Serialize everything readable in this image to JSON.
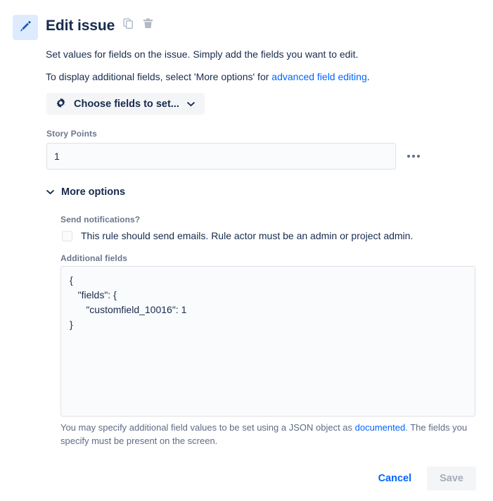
{
  "header": {
    "icon": "pencil-icon",
    "title": "Edit issue",
    "actions": [
      {
        "icon": "copy-icon",
        "name": "duplicate-rule-button"
      },
      {
        "icon": "trash-icon",
        "name": "delete-rule-button"
      }
    ],
    "description_line1": "Set values for fields on the issue. Simply add the fields you want to edit.",
    "description_line2_pre": "To display additional fields, select 'More options' for ",
    "description_line2_link": "advanced field editing",
    "description_line2_post": "."
  },
  "choose_fields": {
    "icon": "gear-icon",
    "label": "Choose fields to set...",
    "chevron": "chevron-down-icon"
  },
  "story_points": {
    "label": "Story Points",
    "value": "1",
    "placeholder": "",
    "menu_icon": "meatball-menu-icon"
  },
  "more_options": {
    "chevron": "chevron-down-icon",
    "label": "More options",
    "expanded": true
  },
  "send_notifications": {
    "label": "Send notifications?",
    "checkbox_checked": false,
    "checkbox_text": "This rule should send emails. Rule actor must be an admin or project admin."
  },
  "additional_fields": {
    "label": "Additional fields",
    "value": "{\n   \"fields\": {\n      \"customfield_10016\": 1\n}",
    "placeholder": "",
    "helper_pre": "You may specify additional field values to be set using a JSON object as ",
    "helper_link": "documented",
    "helper_post": ". The fields you specify must be present on the screen."
  },
  "footer": {
    "cancel_label": "Cancel",
    "save_label": "Save",
    "save_disabled": true
  },
  "colors": {
    "link": "#0065FF",
    "text": "#172B4D",
    "subtle_text": "#6B778C",
    "icon_bg": "#DEEBFF",
    "icon_blue": "#1B4F9C",
    "field_bg": "#FAFBFC",
    "field_border": "#DFE1E6",
    "button_bg": "#F4F5F7",
    "disabled_text": "#A5ADBA"
  }
}
